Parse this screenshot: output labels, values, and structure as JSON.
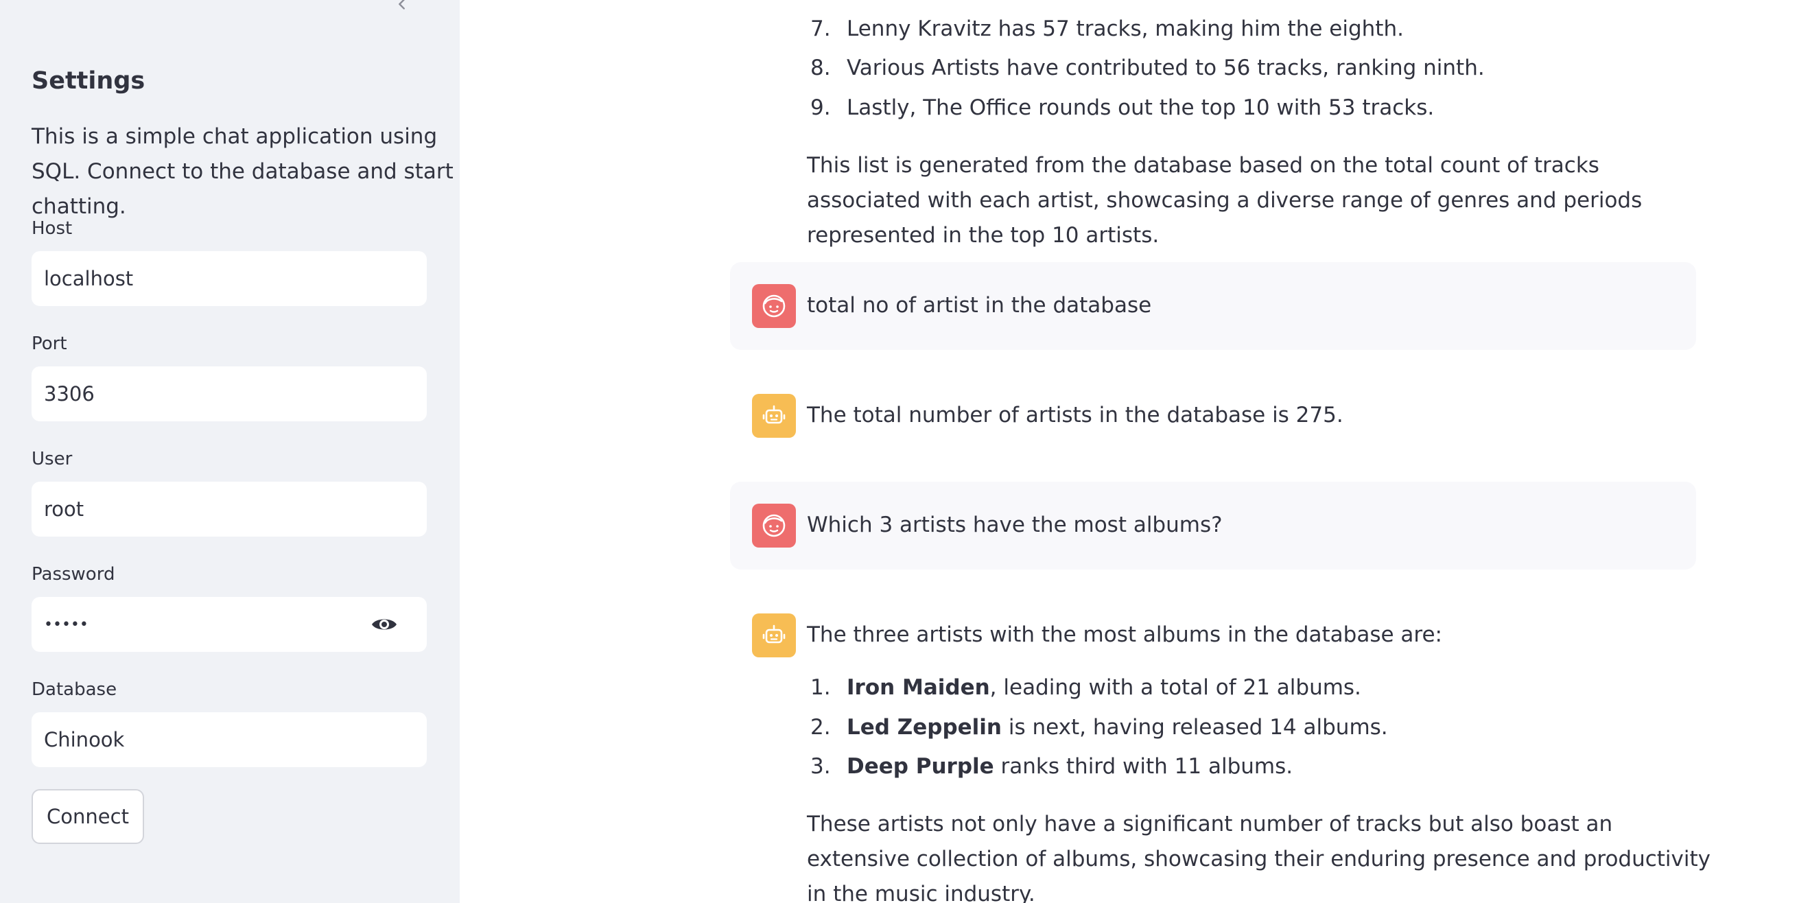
{
  "sidebar": {
    "title": "Settings",
    "description": "This is a simple chat application using SQL. Connect to the database and start chatting.",
    "fields": {
      "host": {
        "label": "Host",
        "value": "localhost"
      },
      "port": {
        "label": "Port",
        "value": "3306"
      },
      "user": {
        "label": "User",
        "value": "root"
      },
      "password": {
        "label": "Password",
        "value": "•••••"
      },
      "database": {
        "label": "Database",
        "value": "Chinook"
      }
    },
    "connect_label": "Connect"
  },
  "chat": {
    "top_list": [
      {
        "num": "7.",
        "text": "Lenny Kravitz has 57 tracks, making him the eighth."
      },
      {
        "num": "8.",
        "text": "Various Artists have contributed to 56 tracks, ranking ninth."
      },
      {
        "num": "9.",
        "text": "Lastly, The Office rounds out the top 10 with 53 tracks."
      }
    ],
    "top_paragraph": "This list is generated from the database based on the total count of tracks associated with each artist, showcasing a diverse range of genres and periods represented in the top 10 artists.",
    "user_msg_1": "total no of artist in the database",
    "bot_msg_1": "The total number of artists in the database is 275.",
    "user_msg_2": "Which 3 artists have the most albums?",
    "bot_msg_2_intro": "The three artists with the most albums in the database are:",
    "albums_list": [
      {
        "num": "1.",
        "name": "Iron Maiden",
        "rest": ", leading with a total of 21 albums."
      },
      {
        "num": "2.",
        "name": "Led Zeppelin",
        "rest": " is next, having released 14 albums."
      },
      {
        "num": "3.",
        "name": "Deep Purple",
        "rest": " ranks third with 11 albums."
      }
    ],
    "bot_msg_2_outro": "These artists not only have a significant number of tracks but also boast an extensive collection of albums, showcasing their enduring presence and productivity in the music industry."
  },
  "colors": {
    "sidebar_bg": "#f0f2f6",
    "user_avatar": "#ee6d6d",
    "bot_avatar": "#f7bd54",
    "user_msg_bg": "#f8f8fb"
  },
  "icons": {
    "collapse": "chevron-left-icon",
    "password_toggle": "eye-icon",
    "user_avatar": "user-face-icon",
    "bot_avatar": "robot-icon"
  }
}
